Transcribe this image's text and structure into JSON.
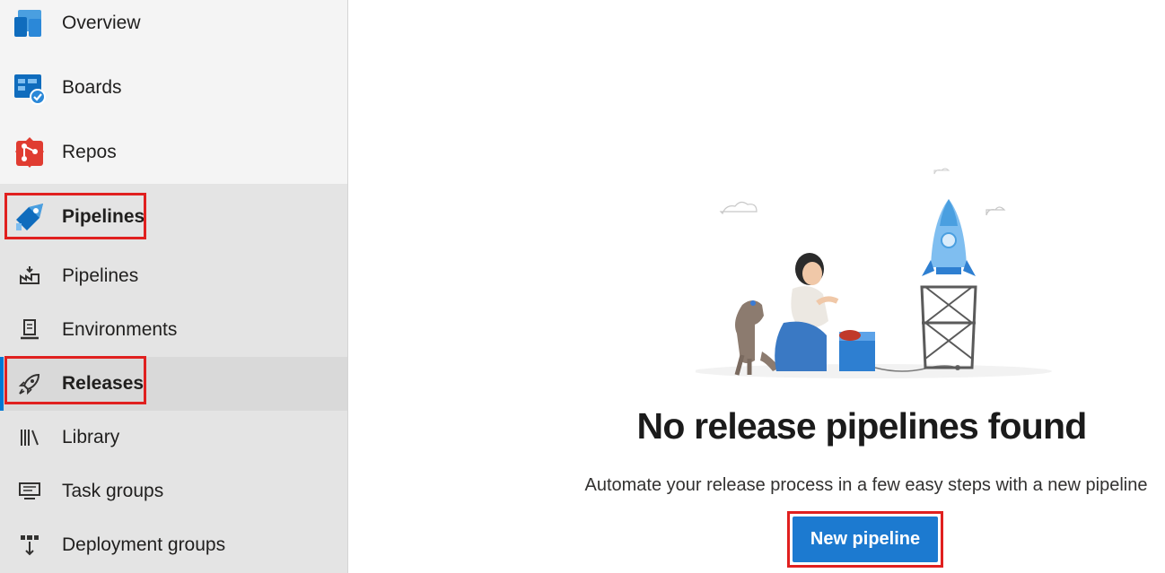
{
  "nav": {
    "overview": "Overview",
    "boards": "Boards",
    "repos": "Repos",
    "pipelines_section": "Pipelines"
  },
  "subnav": [
    {
      "label": "Pipelines",
      "icon": "pipelines-icon"
    },
    {
      "label": "Environments",
      "icon": "environments-icon"
    },
    {
      "label": "Releases",
      "icon": "rocket-icon",
      "selected": true
    },
    {
      "label": "Library",
      "icon": "library-icon"
    },
    {
      "label": "Task groups",
      "icon": "task-groups-icon"
    },
    {
      "label": "Deployment groups",
      "icon": "deployment-groups-icon"
    }
  ],
  "empty_state": {
    "title": "No release pipelines found",
    "description": "Automate your release process in a few easy steps with a new pipeline",
    "button_label": "New pipeline"
  },
  "colors": {
    "accent": "#0078d4",
    "button": "#1c7ad0",
    "highlight_box": "#e0201f",
    "repos_icon": "#e03c31"
  }
}
